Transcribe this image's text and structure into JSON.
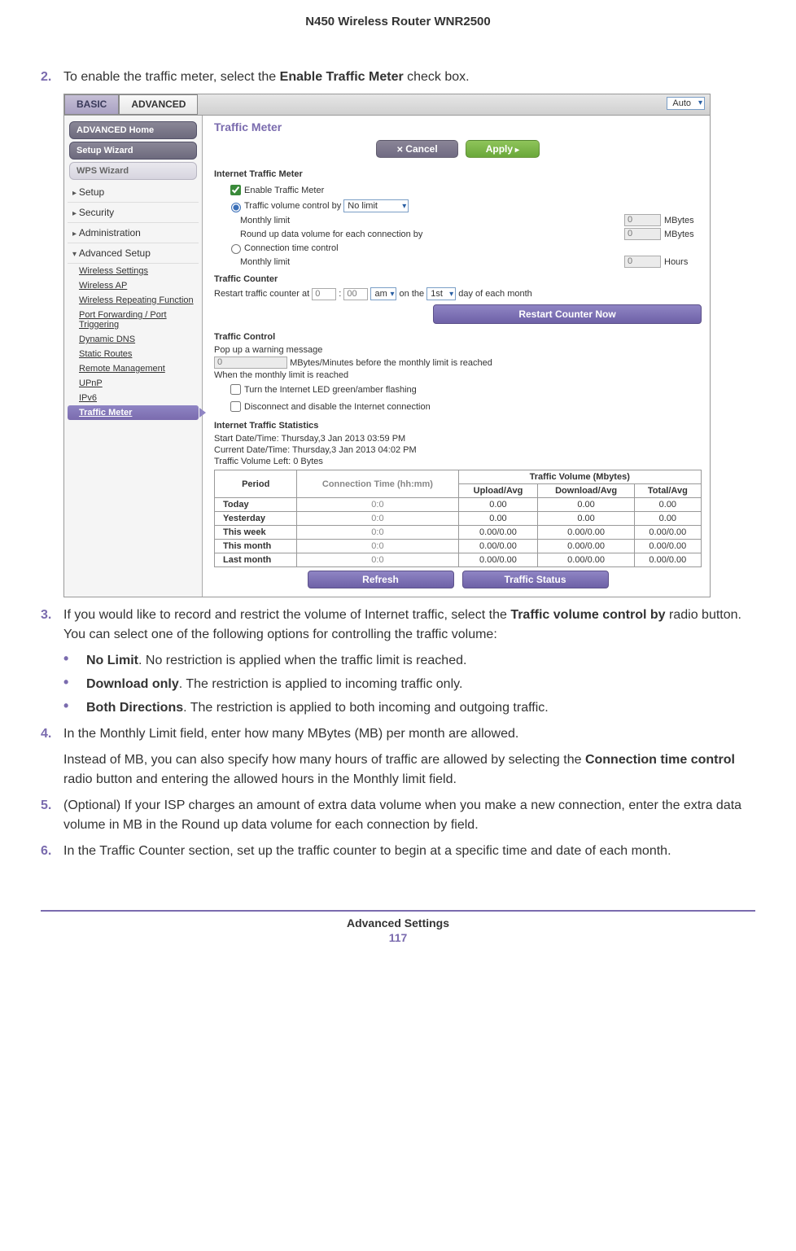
{
  "header": {
    "title": "N450 Wireless Router WNR2500"
  },
  "step2": {
    "num": "2.",
    "pre": "To enable the traffic meter, select the ",
    "bold": "Enable Traffic Meter",
    "post": " check box."
  },
  "ui": {
    "tabs": {
      "basic": "BASIC",
      "advanced": "ADVANCED"
    },
    "auto": "Auto",
    "sidebar": {
      "adv_home": "ADVANCED Home",
      "setup_wizard": "Setup Wizard",
      "wps_wizard": "WPS Wizard",
      "setup": "Setup",
      "security": "Security",
      "administration": "Administration",
      "adv_setup": "Advanced Setup",
      "subs": {
        "wireless_settings": "Wireless Settings",
        "wireless_ap": "Wireless AP",
        "wrf": "Wireless Repeating Function",
        "pfpt": "Port Forwarding / Port Triggering",
        "ddns": "Dynamic DNS",
        "static_routes": "Static Routes",
        "remote_mgmt": "Remote Management",
        "upnp": "UPnP",
        "ipv6": "IPv6",
        "traffic_meter": "Traffic Meter"
      }
    },
    "content": {
      "title": "Traffic Meter",
      "cancel": "Cancel",
      "apply": "Apply",
      "sect_meter": "Internet Traffic Meter",
      "enable": "Enable Traffic Meter",
      "tvc": "Traffic volume control by",
      "tvc_sel": "No limit",
      "monthly_limit": "Monthly limit",
      "mbytes": "MBytes",
      "roundup": "Round up data volume for each connection by",
      "ctc": "Connection time control",
      "hours": "Hours",
      "zero": "0",
      "sect_counter": "Traffic Counter",
      "restart_pre": "Restart traffic counter at",
      "h": "0",
      "m": "00",
      "ampm": "am",
      "on_the": "on the",
      "day": "1st",
      "day_post": "day of each month",
      "restart_btn": "Restart Counter Now",
      "sect_control": "Traffic Control",
      "popup": "Pop up a warning message",
      "before": "MBytes/Minutes before the monthly limit is reached",
      "when": "When the monthly limit is reached",
      "led": "Turn the Internet LED green/amber flashing",
      "disc": "Disconnect and disable the Internet connection",
      "sect_stats": "Internet Traffic Statistics",
      "start": "Start Date/Time: Thursday,3 Jan 2013 03:59 PM",
      "current": "Current Date/Time: Thursday,3 Jan 2013 04:02 PM",
      "left": "Traffic Volume Left: 0 Bytes",
      "table": {
        "period": "Period",
        "conn": "Connection Time (hh:mm)",
        "vol": "Traffic Volume (Mbytes)",
        "up": "Upload/Avg",
        "down": "Download/Avg",
        "total": "Total/Avg",
        "rows": [
          {
            "p": "Today",
            "c": "0:0",
            "u": "0.00",
            "d": "0.00",
            "t": "0.00"
          },
          {
            "p": "Yesterday",
            "c": "0:0",
            "u": "0.00",
            "d": "0.00",
            "t": "0.00"
          },
          {
            "p": "This week",
            "c": "0:0",
            "u": "0.00/0.00",
            "d": "0.00/0.00",
            "t": "0.00/0.00"
          },
          {
            "p": "This month",
            "c": "0:0",
            "u": "0.00/0.00",
            "d": "0.00/0.00",
            "t": "0.00/0.00"
          },
          {
            "p": "Last month",
            "c": "0:0",
            "u": "0.00/0.00",
            "d": "0.00/0.00",
            "t": "0.00/0.00"
          }
        ]
      },
      "refresh": "Refresh",
      "traffic_status": "Traffic Status"
    }
  },
  "step3": {
    "num": "3.",
    "pre": "If you would like to record and restrict the volume of Internet traffic, select the ",
    "b1": "Traffic volume control by",
    "mid": " radio button. You can select one of the following options for controlling the traffic volume:"
  },
  "bullets": {
    "nl_b": "No Limit",
    "nl_t": ". No restriction is applied when the traffic limit is reached.",
    "do_b": "Download only",
    "do_t": ". The restriction is applied to incoming traffic only.",
    "bd_b": "Both Directions",
    "bd_t": ". The restriction is applied to both incoming and outgoing traffic."
  },
  "step4": {
    "num": "4.",
    "text": "In the Monthly Limit field, enter how many MBytes (MB) per month are allowed.",
    "p_pre": "Instead of MB, you can also specify how many hours of traffic are allowed by selecting the ",
    "p_b": "Connection time control",
    "p_post": " radio button and entering the allowed hours in the Monthly limit field."
  },
  "step5": {
    "num": "5.",
    "text": "(Optional) If your ISP charges an amount of extra data volume when you make a new connection, enter the extra data volume in MB in the Round up data volume for each connection by field."
  },
  "step6": {
    "num": "6.",
    "text": "In the Traffic Counter section, set up the traffic counter to begin at a specific time and date of each month."
  },
  "footer": {
    "title": "Advanced Settings",
    "page": "117"
  }
}
